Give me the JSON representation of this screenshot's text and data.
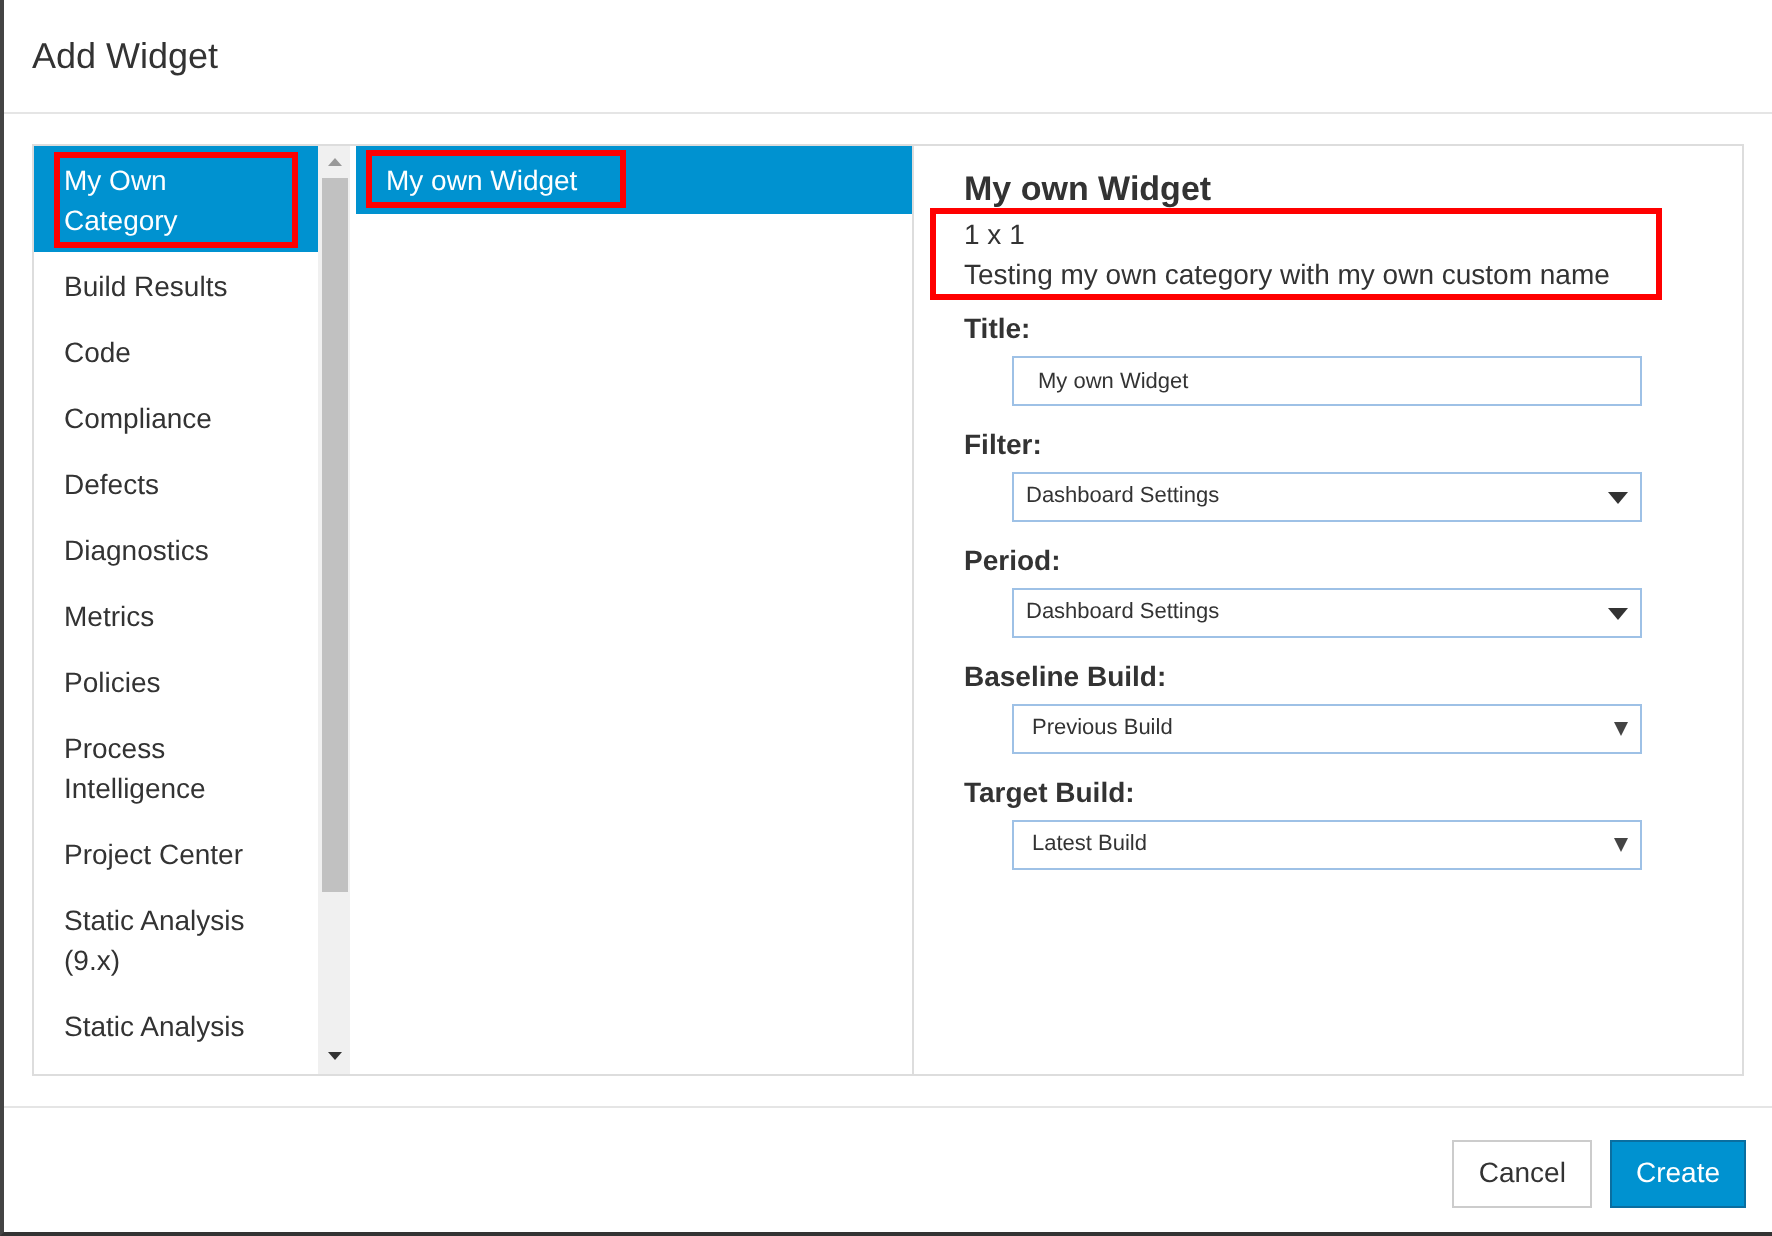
{
  "dialog": {
    "title": "Add Widget"
  },
  "categories": [
    {
      "label": "My Own Category",
      "selected": true,
      "highlighted": true
    },
    {
      "label": "Build Results",
      "selected": false,
      "highlighted": false
    },
    {
      "label": "Code",
      "selected": false,
      "highlighted": false
    },
    {
      "label": "Compliance",
      "selected": false,
      "highlighted": false
    },
    {
      "label": "Defects",
      "selected": false,
      "highlighted": false
    },
    {
      "label": "Diagnostics",
      "selected": false,
      "highlighted": false
    },
    {
      "label": "Metrics",
      "selected": false,
      "highlighted": false
    },
    {
      "label": "Policies",
      "selected": false,
      "highlighted": false
    },
    {
      "label": "Process Intelligence",
      "selected": false,
      "highlighted": false
    },
    {
      "label": "Project Center",
      "selected": false,
      "highlighted": false
    },
    {
      "label": "Static Analysis (9.x)",
      "selected": false,
      "highlighted": false
    },
    {
      "label": "Static Analysis",
      "selected": false,
      "highlighted": false
    }
  ],
  "widgets": [
    {
      "label": "My own Widget",
      "selected": true,
      "highlighted": true
    }
  ],
  "details": {
    "name": "My own Widget",
    "size": "1 x 1",
    "description": "Testing my own category with my own custom name",
    "highlighted": true,
    "fields": [
      {
        "label": "Title:",
        "kind": "text",
        "value": "My own Widget"
      },
      {
        "label": "Filter:",
        "kind": "select",
        "value": "Dashboard Settings"
      },
      {
        "label": "Period:",
        "kind": "select",
        "value": "Dashboard Settings"
      },
      {
        "label": "Baseline Build:",
        "kind": "native-select",
        "value": "Previous Build"
      },
      {
        "label": "Target Build:",
        "kind": "native-select",
        "value": "Latest Build"
      }
    ]
  },
  "buttons": [
    {
      "label": "Cancel",
      "kind": "secondary"
    },
    {
      "label": "Create",
      "kind": "primary"
    }
  ]
}
